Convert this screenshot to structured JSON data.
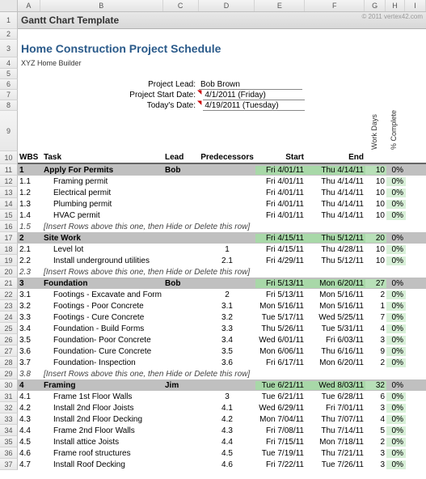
{
  "template_title": "Gantt Chart Template",
  "copyright": "© 2011 vertex42.com",
  "project": {
    "title": "Home Construction Project Schedule",
    "company": "XYZ Home Builder",
    "lead_label": "Project Lead:",
    "lead": "Bob Brown",
    "start_label": "Project Start Date:",
    "start": "4/1/2011 (Friday)",
    "today_label": "Today's Date:",
    "today": "4/19/2011 (Tuesday)"
  },
  "columns": [
    "A",
    "B",
    "C",
    "D",
    "E",
    "F",
    "G",
    "H",
    "I"
  ],
  "row_labels": [
    "1",
    "2",
    "3",
    "4",
    "5",
    "6",
    "7",
    "8",
    "9",
    "10",
    "11",
    "12",
    "13",
    "14",
    "15",
    "16",
    "17",
    "18",
    "19",
    "20",
    "21",
    "22",
    "23",
    "24",
    "25",
    "26",
    "27",
    "28",
    "29",
    "30",
    "31",
    "32",
    "33",
    "34",
    "35",
    "36",
    "37"
  ],
  "headers": {
    "wbs": "WBS",
    "task": "Task",
    "lead": "Lead",
    "pred": "Predecessors",
    "start": "Start",
    "end": "End",
    "work": "Work Days",
    "pct": "% Complete"
  },
  "rows": [
    {
      "type": "section",
      "wbs": "1",
      "task": "Apply For Permits",
      "lead": "Bob",
      "start": "Fri 4/01/11",
      "end": "Thu 4/14/11",
      "work": "10",
      "pct": "0%"
    },
    {
      "type": "task",
      "wbs": "1.1",
      "task": "Framing permit",
      "start": "Fri 4/01/11",
      "end": "Thu 4/14/11",
      "work": "10",
      "pct": "0%"
    },
    {
      "type": "task",
      "wbs": "1.2",
      "task": "Electrical permit",
      "start": "Fri 4/01/11",
      "end": "Thu 4/14/11",
      "work": "10",
      "pct": "0%"
    },
    {
      "type": "task",
      "wbs": "1.3",
      "task": "Plumbing permit",
      "start": "Fri 4/01/11",
      "end": "Thu 4/14/11",
      "work": "10",
      "pct": "0%"
    },
    {
      "type": "task",
      "wbs": "1.4",
      "task": "HVAC permit",
      "start": "Fri 4/01/11",
      "end": "Thu 4/14/11",
      "work": "10",
      "pct": "0%"
    },
    {
      "type": "insert",
      "wbs": "1.5",
      "task": "[Insert Rows above this one, then Hide or Delete this row]"
    },
    {
      "type": "section",
      "wbs": "2",
      "task": "Site Work",
      "start": "Fri 4/15/11",
      "end": "Thu 5/12/11",
      "work": "20",
      "pct": "0%"
    },
    {
      "type": "task",
      "wbs": "2.1",
      "task": "Level lot",
      "pred": "1",
      "start": "Fri 4/15/11",
      "end": "Thu 4/28/11",
      "work": "10",
      "pct": "0%"
    },
    {
      "type": "task",
      "wbs": "2.2",
      "task": "Install underground utilities",
      "pred": "2.1",
      "start": "Fri 4/29/11",
      "end": "Thu 5/12/11",
      "work": "10",
      "pct": "0%"
    },
    {
      "type": "insert",
      "wbs": "2.3",
      "task": "[Insert Rows above this one, then Hide or Delete this row]"
    },
    {
      "type": "section",
      "wbs": "3",
      "task": "Foundation",
      "lead": "Bob",
      "start": "Fri 5/13/11",
      "end": "Mon 6/20/11",
      "work": "27",
      "pct": "0%"
    },
    {
      "type": "task",
      "wbs": "3.1",
      "task": "Footings - Excavate and Form",
      "pred": "2",
      "start": "Fri 5/13/11",
      "end": "Mon 5/16/11",
      "work": "2",
      "pct": "0%"
    },
    {
      "type": "task",
      "wbs": "3.2",
      "task": "Footings - Poor Concrete",
      "pred": "3.1",
      "start": "Mon 5/16/11",
      "end": "Mon 5/16/11",
      "work": "1",
      "pct": "0%"
    },
    {
      "type": "task",
      "wbs": "3.3",
      "task": "Footings - Cure Concrete",
      "pred": "3.2",
      "start": "Tue 5/17/11",
      "end": "Wed 5/25/11",
      "work": "7",
      "pct": "0%"
    },
    {
      "type": "task",
      "wbs": "3.4",
      "task": "Foundation - Build Forms",
      "pred": "3.3",
      "start": "Thu 5/26/11",
      "end": "Tue 5/31/11",
      "work": "4",
      "pct": "0%"
    },
    {
      "type": "task",
      "wbs": "3.5",
      "task": "Foundation- Poor Concrete",
      "pred": "3.4",
      "start": "Wed 6/01/11",
      "end": "Fri 6/03/11",
      "work": "3",
      "pct": "0%"
    },
    {
      "type": "task",
      "wbs": "3.6",
      "task": "Foundation- Cure Concrete",
      "pred": "3.5",
      "start": "Mon 6/06/11",
      "end": "Thu 6/16/11",
      "work": "9",
      "pct": "0%"
    },
    {
      "type": "task",
      "wbs": "3.7",
      "task": "Foundation- Inspection",
      "pred": "3.6",
      "start": "Fri 6/17/11",
      "end": "Mon 6/20/11",
      "work": "2",
      "pct": "0%"
    },
    {
      "type": "insert",
      "wbs": "3.8",
      "task": "[Insert Rows above this one, then Hide or Delete this row]"
    },
    {
      "type": "section",
      "wbs": "4",
      "task": "Framing",
      "lead": "Jim",
      "start": "Tue 6/21/11",
      "end": "Wed 8/03/11",
      "work": "32",
      "pct": "0%"
    },
    {
      "type": "task",
      "wbs": "4.1",
      "task": "Frame 1st Floor Walls",
      "pred": "3",
      "start": "Tue 6/21/11",
      "end": "Tue 6/28/11",
      "work": "6",
      "pct": "0%"
    },
    {
      "type": "task",
      "wbs": "4.2",
      "task": "Install 2nd Floor Joists",
      "pred": "4.1",
      "start": "Wed 6/29/11",
      "end": "Fri 7/01/11",
      "work": "3",
      "pct": "0%"
    },
    {
      "type": "task",
      "wbs": "4.3",
      "task": "Install 2nd Floor Decking",
      "pred": "4.2",
      "start": "Mon 7/04/11",
      "end": "Thu 7/07/11",
      "work": "4",
      "pct": "0%"
    },
    {
      "type": "task",
      "wbs": "4.4",
      "task": "Frame 2nd Floor Walls",
      "pred": "4.3",
      "start": "Fri 7/08/11",
      "end": "Thu 7/14/11",
      "work": "5",
      "pct": "0%"
    },
    {
      "type": "task",
      "wbs": "4.5",
      "task": "Install attice Joists",
      "pred": "4.4",
      "start": "Fri 7/15/11",
      "end": "Mon 7/18/11",
      "work": "2",
      "pct": "0%"
    },
    {
      "type": "task",
      "wbs": "4.6",
      "task": "Frame roof structures",
      "pred": "4.5",
      "start": "Tue 7/19/11",
      "end": "Thu 7/21/11",
      "work": "3",
      "pct": "0%"
    },
    {
      "type": "task",
      "wbs": "4.7",
      "task": "Install Roof Decking",
      "pred": "4.6",
      "start": "Fri 7/22/11",
      "end": "Tue 7/26/11",
      "work": "3",
      "pct": "0%"
    }
  ]
}
